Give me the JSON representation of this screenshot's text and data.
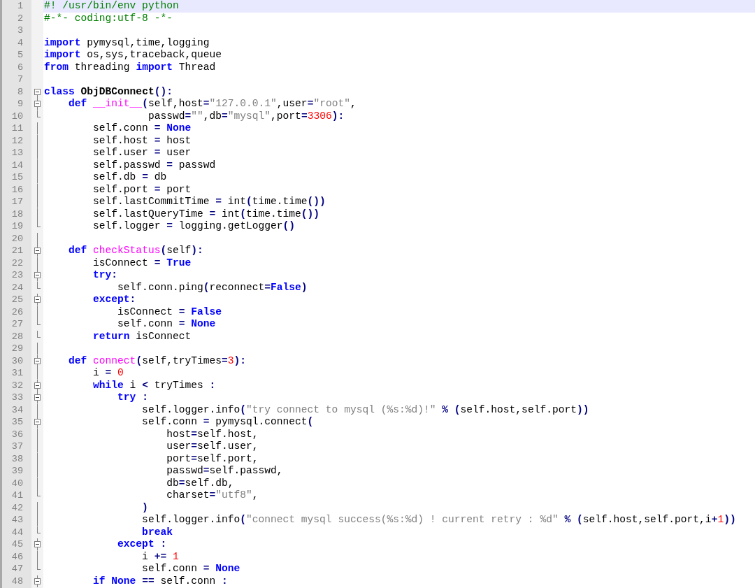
{
  "lines": [
    {
      "no": "1",
      "selected": true,
      "tokens": [
        {
          "kind": "comment",
          "text": "#! /usr/bin/env python"
        }
      ]
    },
    {
      "no": "2",
      "selected": false,
      "tokens": [
        {
          "kind": "comment",
          "text": "#-*- coding:utf-8 -*-"
        }
      ]
    },
    {
      "no": "3",
      "selected": false
    },
    {
      "no": "4",
      "selected": false,
      "tokens": [
        {
          "kind": "keyword",
          "text": "import"
        },
        {
          "kind": "plain",
          "text": " pymysql,time,logging"
        }
      ]
    },
    {
      "no": "5",
      "selected": false,
      "tokens": [
        {
          "kind": "keyword",
          "text": "import"
        },
        {
          "kind": "plain",
          "text": " os,sys,traceback,queue"
        }
      ]
    },
    {
      "no": "6",
      "selected": false,
      "tokens": [
        {
          "kind": "keyword",
          "text": "from"
        },
        {
          "kind": "plain",
          "text": " threading "
        },
        {
          "kind": "keyword",
          "text": "import"
        },
        {
          "kind": "plain",
          "text": " Thread"
        }
      ]
    },
    {
      "no": "7",
      "selected": false
    },
    {
      "no": "8",
      "selected": false,
      "kind": "fold-open",
      "tokens": [
        {
          "kind": "keyword",
          "text": "class"
        },
        {
          "kind": "classname",
          "text": " ObjDBConnect"
        },
        {
          "kind": "operator",
          "text": "():"
        }
      ]
    },
    {
      "no": "9",
      "selected": false,
      "kind": "fold-open",
      "tokens": [
        {
          "kind": "keyword",
          "text": "    def"
        },
        {
          "kind": "function",
          "text": " __init__"
        },
        {
          "kind": "operator",
          "text": "("
        },
        {
          "kind": "plain",
          "text": "self,host"
        },
        {
          "kind": "operator",
          "text": "="
        },
        {
          "kind": "string",
          "text": "\"127.0.0.1\""
        },
        {
          "kind": "plain",
          "text": ",user"
        },
        {
          "kind": "operator",
          "text": "="
        },
        {
          "kind": "string",
          "text": "\"root\""
        },
        {
          "kind": "plain",
          "text": ","
        }
      ]
    },
    {
      "no": "10",
      "selected": false,
      "kind": "fold-end",
      "tokens": [
        {
          "kind": "plain",
          "text": "                 passwd"
        },
        {
          "kind": "operator",
          "text": "="
        },
        {
          "kind": "string",
          "text": "\"\""
        },
        {
          "kind": "plain",
          "text": ",db"
        },
        {
          "kind": "operator",
          "text": "="
        },
        {
          "kind": "string",
          "text": "\"mysql\""
        },
        {
          "kind": "plain",
          "text": ",port"
        },
        {
          "kind": "operator",
          "text": "="
        },
        {
          "kind": "number",
          "text": "3306"
        },
        {
          "kind": "operator",
          "text": "):"
        }
      ]
    },
    {
      "no": "11",
      "selected": false,
      "kind": "fold-line",
      "tokens": [
        {
          "kind": "plain",
          "text": "        self.conn "
        },
        {
          "kind": "operator",
          "text": "="
        },
        {
          "kind": "keyword",
          "text": " None"
        }
      ]
    },
    {
      "no": "12",
      "selected": false,
      "kind": "fold-line",
      "tokens": [
        {
          "kind": "plain",
          "text": "        self.host "
        },
        {
          "kind": "operator",
          "text": "="
        },
        {
          "kind": "plain",
          "text": " host"
        }
      ]
    },
    {
      "no": "13",
      "selected": false,
      "kind": "fold-line",
      "tokens": [
        {
          "kind": "plain",
          "text": "        self.user "
        },
        {
          "kind": "operator",
          "text": "="
        },
        {
          "kind": "plain",
          "text": " user"
        }
      ]
    },
    {
      "no": "14",
      "selected": false,
      "kind": "fold-line",
      "tokens": [
        {
          "kind": "plain",
          "text": "        self.passwd "
        },
        {
          "kind": "operator",
          "text": "="
        },
        {
          "kind": "plain",
          "text": " passwd"
        }
      ]
    },
    {
      "no": "15",
      "selected": false,
      "kind": "fold-line",
      "tokens": [
        {
          "kind": "plain",
          "text": "        self.db "
        },
        {
          "kind": "operator",
          "text": "="
        },
        {
          "kind": "plain",
          "text": " db"
        }
      ]
    },
    {
      "no": "16",
      "selected": false,
      "kind": "fold-line",
      "tokens": [
        {
          "kind": "plain",
          "text": "        self.port "
        },
        {
          "kind": "operator",
          "text": "="
        },
        {
          "kind": "plain",
          "text": " port"
        }
      ]
    },
    {
      "no": "17",
      "selected": false,
      "kind": "fold-line",
      "tokens": [
        {
          "kind": "plain",
          "text": "        self.lastCommitTime "
        },
        {
          "kind": "operator",
          "text": "="
        },
        {
          "kind": "plain",
          "text": " int"
        },
        {
          "kind": "operator",
          "text": "("
        },
        {
          "kind": "plain",
          "text": "time.time"
        },
        {
          "kind": "operator",
          "text": "())"
        }
      ]
    },
    {
      "no": "18",
      "selected": false,
      "kind": "fold-line",
      "tokens": [
        {
          "kind": "plain",
          "text": "        self.lastQueryTime "
        },
        {
          "kind": "operator",
          "text": "="
        },
        {
          "kind": "plain",
          "text": " int"
        },
        {
          "kind": "operator",
          "text": "("
        },
        {
          "kind": "plain",
          "text": "time.time"
        },
        {
          "kind": "operator",
          "text": "())"
        }
      ]
    },
    {
      "no": "19",
      "selected": false,
      "kind": "fold-end",
      "tokens": [
        {
          "kind": "plain",
          "text": "        self.logger "
        },
        {
          "kind": "operator",
          "text": "="
        },
        {
          "kind": "plain",
          "text": " logging.getLogger"
        },
        {
          "kind": "operator",
          "text": "()"
        }
      ]
    },
    {
      "no": "20",
      "selected": false,
      "kind": "fold-line"
    },
    {
      "no": "21",
      "selected": false,
      "kind": "fold-open",
      "tokens": [
        {
          "kind": "keyword",
          "text": "    def"
        },
        {
          "kind": "function",
          "text": " checkStatus"
        },
        {
          "kind": "operator",
          "text": "("
        },
        {
          "kind": "plain",
          "text": "self"
        },
        {
          "kind": "operator",
          "text": "):"
        }
      ]
    },
    {
      "no": "22",
      "selected": false,
      "kind": "fold-line",
      "tokens": [
        {
          "kind": "plain",
          "text": "        isConnect "
        },
        {
          "kind": "operator",
          "text": "="
        },
        {
          "kind": "keyword",
          "text": " True"
        }
      ]
    },
    {
      "no": "23",
      "selected": false,
      "kind": "fold-open",
      "tokens": [
        {
          "kind": "keyword",
          "text": "        try"
        },
        {
          "kind": "operator",
          "text": ":"
        }
      ]
    },
    {
      "no": "24",
      "selected": false,
      "kind": "fold-end",
      "tokens": [
        {
          "kind": "plain",
          "text": "            self.conn.ping"
        },
        {
          "kind": "operator",
          "text": "("
        },
        {
          "kind": "plain",
          "text": "reconnect"
        },
        {
          "kind": "operator",
          "text": "="
        },
        {
          "kind": "keyword",
          "text": "False"
        },
        {
          "kind": "operator",
          "text": ")"
        }
      ]
    },
    {
      "no": "25",
      "selected": false,
      "kind": "fold-open",
      "tokens": [
        {
          "kind": "keyword",
          "text": "        except"
        },
        {
          "kind": "operator",
          "text": ":"
        }
      ]
    },
    {
      "no": "26",
      "selected": false,
      "kind": "fold-line",
      "tokens": [
        {
          "kind": "plain",
          "text": "            isConnect "
        },
        {
          "kind": "operator",
          "text": "="
        },
        {
          "kind": "keyword",
          "text": " False"
        }
      ]
    },
    {
      "no": "27",
      "selected": false,
      "kind": "fold-end",
      "tokens": [
        {
          "kind": "plain",
          "text": "            self.conn "
        },
        {
          "kind": "operator",
          "text": "="
        },
        {
          "kind": "keyword",
          "text": " None"
        }
      ]
    },
    {
      "no": "28",
      "selected": false,
      "kind": "fold-end",
      "tokens": [
        {
          "kind": "keyword",
          "text": "        return"
        },
        {
          "kind": "plain",
          "text": " isConnect"
        }
      ]
    },
    {
      "no": "29",
      "selected": false,
      "kind": "fold-line"
    },
    {
      "no": "30",
      "selected": false,
      "kind": "fold-open",
      "tokens": [
        {
          "kind": "keyword",
          "text": "    def"
        },
        {
          "kind": "function",
          "text": " connect"
        },
        {
          "kind": "operator",
          "text": "("
        },
        {
          "kind": "plain",
          "text": "self,tryTimes"
        },
        {
          "kind": "operator",
          "text": "="
        },
        {
          "kind": "number",
          "text": "3"
        },
        {
          "kind": "operator",
          "text": "):"
        }
      ]
    },
    {
      "no": "31",
      "selected": false,
      "kind": "fold-line",
      "tokens": [
        {
          "kind": "plain",
          "text": "        i "
        },
        {
          "kind": "operator",
          "text": "="
        },
        {
          "kind": "number",
          "text": " 0"
        }
      ]
    },
    {
      "no": "32",
      "selected": false,
      "kind": "fold-open",
      "tokens": [
        {
          "kind": "keyword",
          "text": "        while"
        },
        {
          "kind": "plain",
          "text": " i "
        },
        {
          "kind": "operator",
          "text": "<"
        },
        {
          "kind": "plain",
          "text": " tryTimes "
        },
        {
          "kind": "operator",
          "text": ":"
        }
      ]
    },
    {
      "no": "33",
      "selected": false,
      "kind": "fold-open",
      "tokens": [
        {
          "kind": "keyword",
          "text": "            try"
        },
        {
          "kind": "operator",
          "text": " :"
        }
      ]
    },
    {
      "no": "34",
      "selected": false,
      "kind": "fold-line",
      "tokens": [
        {
          "kind": "plain",
          "text": "                self.logger.info"
        },
        {
          "kind": "operator",
          "text": "("
        },
        {
          "kind": "string",
          "text": "\"try connect to mysql (%s:%d)!\""
        },
        {
          "kind": "operator",
          "text": " %"
        },
        {
          "kind": "operator",
          "text": " ("
        },
        {
          "kind": "plain",
          "text": "self.host,self.port"
        },
        {
          "kind": "operator",
          "text": "))"
        }
      ]
    },
    {
      "no": "35",
      "selected": false,
      "kind": "fold-open",
      "tokens": [
        {
          "kind": "plain",
          "text": "                self.conn "
        },
        {
          "kind": "operator",
          "text": "="
        },
        {
          "kind": "plain",
          "text": " pymysql.connect"
        },
        {
          "kind": "operator",
          "text": "("
        }
      ]
    },
    {
      "no": "36",
      "selected": false,
      "kind": "fold-line",
      "tokens": [
        {
          "kind": "plain",
          "text": "                    host"
        },
        {
          "kind": "operator",
          "text": "="
        },
        {
          "kind": "plain",
          "text": "self.host,"
        }
      ]
    },
    {
      "no": "37",
      "selected": false,
      "kind": "fold-line",
      "tokens": [
        {
          "kind": "plain",
          "text": "                    user"
        },
        {
          "kind": "operator",
          "text": "="
        },
        {
          "kind": "plain",
          "text": "self.user,"
        }
      ]
    },
    {
      "no": "38",
      "selected": false,
      "kind": "fold-line",
      "tokens": [
        {
          "kind": "plain",
          "text": "                    port"
        },
        {
          "kind": "operator",
          "text": "="
        },
        {
          "kind": "plain",
          "text": "self.port,"
        }
      ]
    },
    {
      "no": "39",
      "selected": false,
      "kind": "fold-line",
      "tokens": [
        {
          "kind": "plain",
          "text": "                    passwd"
        },
        {
          "kind": "operator",
          "text": "="
        },
        {
          "kind": "plain",
          "text": "self.passwd,"
        }
      ]
    },
    {
      "no": "40",
      "selected": false,
      "kind": "fold-line",
      "tokens": [
        {
          "kind": "plain",
          "text": "                    db"
        },
        {
          "kind": "operator",
          "text": "="
        },
        {
          "kind": "plain",
          "text": "self.db,"
        }
      ]
    },
    {
      "no": "41",
      "selected": false,
      "kind": "fold-end",
      "tokens": [
        {
          "kind": "plain",
          "text": "                    charset"
        },
        {
          "kind": "operator",
          "text": "="
        },
        {
          "kind": "string",
          "text": "\"utf8\""
        },
        {
          "kind": "plain",
          "text": ","
        }
      ]
    },
    {
      "no": "42",
      "selected": false,
      "kind": "fold-line",
      "tokens": [
        {
          "kind": "operator",
          "text": "                )"
        }
      ]
    },
    {
      "no": "43",
      "selected": false,
      "kind": "fold-line",
      "tokens": [
        {
          "kind": "plain",
          "text": "                self.logger.info"
        },
        {
          "kind": "operator",
          "text": "("
        },
        {
          "kind": "string",
          "text": "\"connect mysql success(%s:%d) ! current retry : %d\""
        },
        {
          "kind": "operator",
          "text": " %"
        },
        {
          "kind": "operator",
          "text": " ("
        },
        {
          "kind": "plain",
          "text": "self.host,self.port,i"
        },
        {
          "kind": "operator",
          "text": "+"
        },
        {
          "kind": "number",
          "text": "1"
        },
        {
          "kind": "operator",
          "text": "))"
        }
      ]
    },
    {
      "no": "44",
      "selected": false,
      "kind": "fold-end",
      "tokens": [
        {
          "kind": "keyword",
          "text": "                break"
        }
      ]
    },
    {
      "no": "45",
      "selected": false,
      "kind": "fold-open",
      "tokens": [
        {
          "kind": "keyword",
          "text": "            except"
        },
        {
          "kind": "operator",
          "text": " :"
        }
      ]
    },
    {
      "no": "46",
      "selected": false,
      "kind": "fold-line",
      "tokens": [
        {
          "kind": "plain",
          "text": "                i "
        },
        {
          "kind": "operator",
          "text": "+="
        },
        {
          "kind": "number",
          "text": " 1"
        }
      ]
    },
    {
      "no": "47",
      "selected": false,
      "kind": "fold-end",
      "tokens": [
        {
          "kind": "plain",
          "text": "                self.conn "
        },
        {
          "kind": "operator",
          "text": "="
        },
        {
          "kind": "keyword",
          "text": " None"
        }
      ]
    },
    {
      "no": "48",
      "selected": false,
      "kind": "fold-open",
      "tokens": [
        {
          "kind": "keyword",
          "text": "        if"
        },
        {
          "kind": "keyword",
          "text": " None"
        },
        {
          "kind": "operator",
          "text": " =="
        },
        {
          "kind": "plain",
          "text": " self.conn "
        },
        {
          "kind": "operator",
          "text": ":"
        }
      ]
    }
  ]
}
